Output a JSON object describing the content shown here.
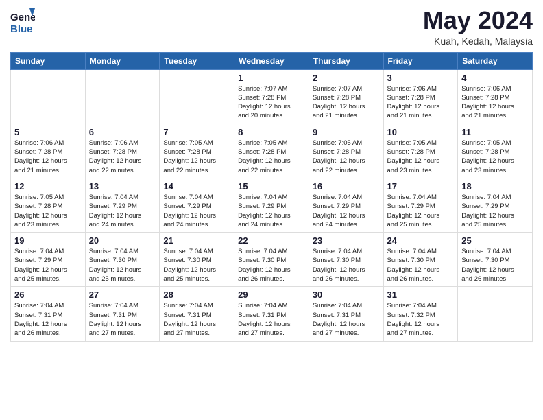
{
  "header": {
    "logo_line1": "General",
    "logo_line2": "Blue",
    "month_title": "May 2024",
    "location": "Kuah, Kedah, Malaysia"
  },
  "columns": [
    "Sunday",
    "Monday",
    "Tuesday",
    "Wednesday",
    "Thursday",
    "Friday",
    "Saturday"
  ],
  "weeks": [
    [
      {
        "day": "",
        "info": ""
      },
      {
        "day": "",
        "info": ""
      },
      {
        "day": "",
        "info": ""
      },
      {
        "day": "1",
        "info": "Sunrise: 7:07 AM\nSunset: 7:28 PM\nDaylight: 12 hours\nand 20 minutes."
      },
      {
        "day": "2",
        "info": "Sunrise: 7:07 AM\nSunset: 7:28 PM\nDaylight: 12 hours\nand 21 minutes."
      },
      {
        "day": "3",
        "info": "Sunrise: 7:06 AM\nSunset: 7:28 PM\nDaylight: 12 hours\nand 21 minutes."
      },
      {
        "day": "4",
        "info": "Sunrise: 7:06 AM\nSunset: 7:28 PM\nDaylight: 12 hours\nand 21 minutes."
      }
    ],
    [
      {
        "day": "5",
        "info": "Sunrise: 7:06 AM\nSunset: 7:28 PM\nDaylight: 12 hours\nand 21 minutes."
      },
      {
        "day": "6",
        "info": "Sunrise: 7:06 AM\nSunset: 7:28 PM\nDaylight: 12 hours\nand 22 minutes."
      },
      {
        "day": "7",
        "info": "Sunrise: 7:05 AM\nSunset: 7:28 PM\nDaylight: 12 hours\nand 22 minutes."
      },
      {
        "day": "8",
        "info": "Sunrise: 7:05 AM\nSunset: 7:28 PM\nDaylight: 12 hours\nand 22 minutes."
      },
      {
        "day": "9",
        "info": "Sunrise: 7:05 AM\nSunset: 7:28 PM\nDaylight: 12 hours\nand 22 minutes."
      },
      {
        "day": "10",
        "info": "Sunrise: 7:05 AM\nSunset: 7:28 PM\nDaylight: 12 hours\nand 23 minutes."
      },
      {
        "day": "11",
        "info": "Sunrise: 7:05 AM\nSunset: 7:28 PM\nDaylight: 12 hours\nand 23 minutes."
      }
    ],
    [
      {
        "day": "12",
        "info": "Sunrise: 7:05 AM\nSunset: 7:28 PM\nDaylight: 12 hours\nand 23 minutes."
      },
      {
        "day": "13",
        "info": "Sunrise: 7:04 AM\nSunset: 7:29 PM\nDaylight: 12 hours\nand 24 minutes."
      },
      {
        "day": "14",
        "info": "Sunrise: 7:04 AM\nSunset: 7:29 PM\nDaylight: 12 hours\nand 24 minutes."
      },
      {
        "day": "15",
        "info": "Sunrise: 7:04 AM\nSunset: 7:29 PM\nDaylight: 12 hours\nand 24 minutes."
      },
      {
        "day": "16",
        "info": "Sunrise: 7:04 AM\nSunset: 7:29 PM\nDaylight: 12 hours\nand 24 minutes."
      },
      {
        "day": "17",
        "info": "Sunrise: 7:04 AM\nSunset: 7:29 PM\nDaylight: 12 hours\nand 25 minutes."
      },
      {
        "day": "18",
        "info": "Sunrise: 7:04 AM\nSunset: 7:29 PM\nDaylight: 12 hours\nand 25 minutes."
      }
    ],
    [
      {
        "day": "19",
        "info": "Sunrise: 7:04 AM\nSunset: 7:29 PM\nDaylight: 12 hours\nand 25 minutes."
      },
      {
        "day": "20",
        "info": "Sunrise: 7:04 AM\nSunset: 7:30 PM\nDaylight: 12 hours\nand 25 minutes."
      },
      {
        "day": "21",
        "info": "Sunrise: 7:04 AM\nSunset: 7:30 PM\nDaylight: 12 hours\nand 25 minutes."
      },
      {
        "day": "22",
        "info": "Sunrise: 7:04 AM\nSunset: 7:30 PM\nDaylight: 12 hours\nand 26 minutes."
      },
      {
        "day": "23",
        "info": "Sunrise: 7:04 AM\nSunset: 7:30 PM\nDaylight: 12 hours\nand 26 minutes."
      },
      {
        "day": "24",
        "info": "Sunrise: 7:04 AM\nSunset: 7:30 PM\nDaylight: 12 hours\nand 26 minutes."
      },
      {
        "day": "25",
        "info": "Sunrise: 7:04 AM\nSunset: 7:30 PM\nDaylight: 12 hours\nand 26 minutes."
      }
    ],
    [
      {
        "day": "26",
        "info": "Sunrise: 7:04 AM\nSunset: 7:31 PM\nDaylight: 12 hours\nand 26 minutes."
      },
      {
        "day": "27",
        "info": "Sunrise: 7:04 AM\nSunset: 7:31 PM\nDaylight: 12 hours\nand 27 minutes."
      },
      {
        "day": "28",
        "info": "Sunrise: 7:04 AM\nSunset: 7:31 PM\nDaylight: 12 hours\nand 27 minutes."
      },
      {
        "day": "29",
        "info": "Sunrise: 7:04 AM\nSunset: 7:31 PM\nDaylight: 12 hours\nand 27 minutes."
      },
      {
        "day": "30",
        "info": "Sunrise: 7:04 AM\nSunset: 7:31 PM\nDaylight: 12 hours\nand 27 minutes."
      },
      {
        "day": "31",
        "info": "Sunrise: 7:04 AM\nSunset: 7:32 PM\nDaylight: 12 hours\nand 27 minutes."
      },
      {
        "day": "",
        "info": ""
      }
    ]
  ]
}
